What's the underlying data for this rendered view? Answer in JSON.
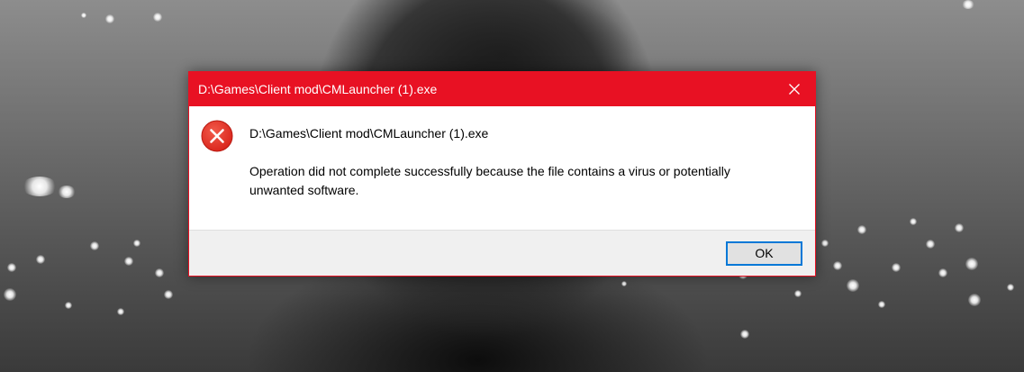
{
  "dialog": {
    "title": "D:\\Games\\Client mod\\CMLauncher (1).exe",
    "file_path": "D:\\Games\\Client mod\\CMLauncher (1).exe",
    "message": "Operation did not complete successfully because the file contains a virus or potentially unwanted software.",
    "ok_label": "OK",
    "icon": "error-icon",
    "close_icon": "close-icon"
  },
  "colors": {
    "titlebar": "#e81123",
    "error_icon": "#e81123",
    "button_focus_border": "#0078d7",
    "footer": "#f0f0f0"
  }
}
